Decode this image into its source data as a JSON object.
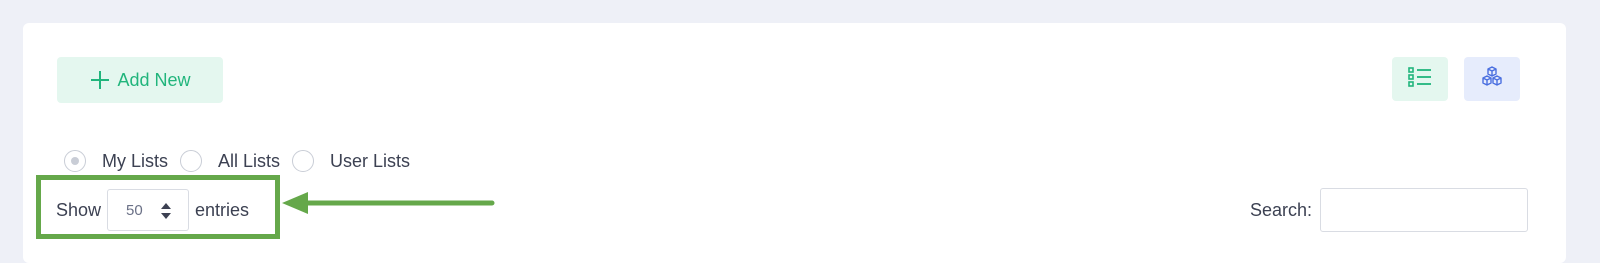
{
  "toolbar": {
    "add_new_label": "Add New",
    "add_new_icon": "plus-icon",
    "list_view_icon": "list-view-icon",
    "grid_view_icon": "cubes-icon"
  },
  "filters": {
    "options": [
      {
        "label": "My Lists",
        "selected": true
      },
      {
        "label": "All Lists",
        "selected": false
      },
      {
        "label": "User Lists",
        "selected": false
      }
    ]
  },
  "entries": {
    "show_label": "Show",
    "page_size": "50",
    "entries_label": "entries"
  },
  "search": {
    "label": "Search:",
    "value": ""
  },
  "colors": {
    "accent_green": "#21b57c",
    "accent_blue": "#4a6fe0",
    "annotation_green": "#65a84a"
  }
}
